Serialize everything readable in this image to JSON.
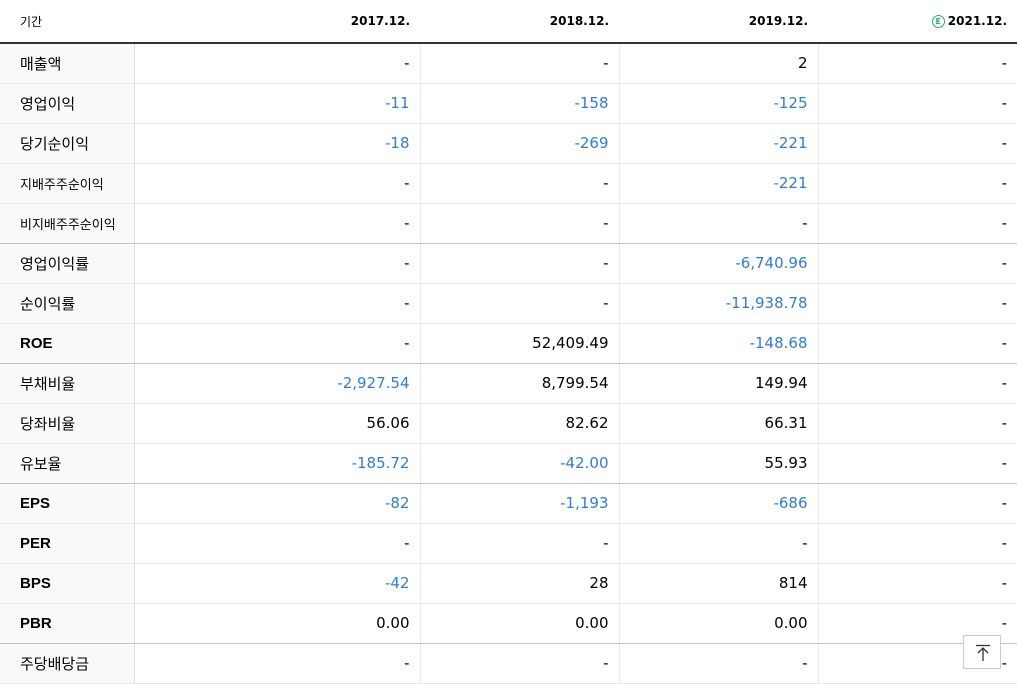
{
  "header": {
    "period_label": "기간",
    "col1": "2017.12.",
    "col2": "2018.12.",
    "col3": "2019.12.",
    "col4": "2021.12.",
    "estimate_icon": "E"
  },
  "rows": [
    {
      "label": "매출액",
      "v": [
        "-",
        "-",
        "2",
        "-"
      ]
    },
    {
      "label": "영업이익",
      "v": [
        "-11",
        "-158",
        "-125",
        "-"
      ]
    },
    {
      "label": "당기순이익",
      "v": [
        "-18",
        "-269",
        "-221",
        "-"
      ]
    },
    {
      "label": "지배주주순이익",
      "v": [
        "-",
        "-",
        "-221",
        "-"
      ]
    },
    {
      "label": "비지배주주순이익",
      "v": [
        "-",
        "-",
        "-",
        "-"
      ]
    },
    {
      "label": "영업이익률",
      "v": [
        "-",
        "-",
        "-6,740.96",
        "-"
      ]
    },
    {
      "label": "순이익률",
      "v": [
        "-",
        "-",
        "-11,938.78",
        "-"
      ]
    },
    {
      "label": "ROE",
      "v": [
        "-",
        "52,409.49",
        "-148.68",
        "-"
      ]
    },
    {
      "label": "부채비율",
      "v": [
        "-2,927.54",
        "8,799.54",
        "149.94",
        "-"
      ]
    },
    {
      "label": "당좌비율",
      "v": [
        "56.06",
        "82.62",
        "66.31",
        "-"
      ]
    },
    {
      "label": "유보율",
      "v": [
        "-185.72",
        "-42.00",
        "55.93",
        "-"
      ]
    },
    {
      "label": "EPS",
      "v": [
        "-82",
        "-1,193",
        "-686",
        "-"
      ]
    },
    {
      "label": "PER",
      "v": [
        "-",
        "-",
        "-",
        "-"
      ]
    },
    {
      "label": "BPS",
      "v": [
        "-42",
        "28",
        "814",
        "-"
      ]
    },
    {
      "label": "PBR",
      "v": [
        "0.00",
        "0.00",
        "0.00",
        "-"
      ]
    },
    {
      "label": "주당배당금",
      "v": [
        "-",
        "-",
        "-",
        "-"
      ]
    }
  ],
  "colors": {
    "negative": "#2f7dd3",
    "estimate": "#27b06f"
  },
  "scroll_top_icon": "arrow-up-to-top-icon"
}
